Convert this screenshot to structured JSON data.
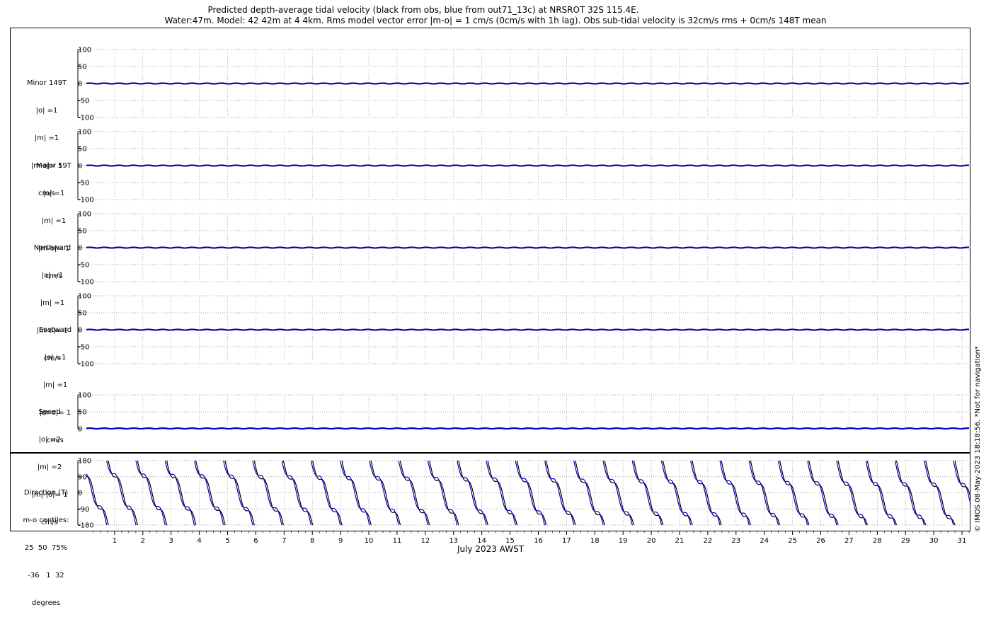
{
  "title_line1": "Predicted depth-average tidal velocity (black from obs, blue from out71_13c) at NRSROT 32S 115.4E.",
  "title_line2": "Water:47m. Model: 42 42m at 4 4km. Rms model vector error |m-o| = 1 cm/s (0cm/s with 1h lag). Obs sub-tidal velocity is 32cm/s rms + 0cm/s 148T mean",
  "credit": "© IMOS 08-May-2023 18:18:56. *Not for navigation*",
  "colors": {
    "obs": "#000000",
    "model": "#0000cc",
    "grid": "#888888"
  },
  "chart_data": [
    {
      "type": "line",
      "panel_label": [
        "Minor 149T",
        "|o| =1",
        "|m| =1",
        "|m-o|= 1",
        "cm/s"
      ],
      "yticks": [
        100,
        50,
        0,
        -50,
        -100
      ],
      "ytick_labels": [
        "100",
        "50",
        "0",
        "-50",
        "-100"
      ],
      "ylim": [
        -100,
        100
      ],
      "series": [
        {
          "color": "obs",
          "amplitude": 1,
          "mean": 0
        },
        {
          "color": "model",
          "amplitude": 1,
          "mean": 0
        }
      ]
    },
    {
      "type": "line",
      "panel_label": [
        "Major 59T",
        "|o| =1",
        "|m| =1",
        "|m-o|= 1",
        "cm/s"
      ],
      "yticks": [
        100,
        50,
        0,
        -50,
        -100
      ],
      "ytick_labels": [
        "100",
        "50",
        "0",
        "-50",
        "-100"
      ],
      "ylim": [
        -100,
        100
      ],
      "series": [
        {
          "color": "obs",
          "amplitude": 1,
          "mean": 0
        },
        {
          "color": "model",
          "amplitude": 1,
          "mean": 0
        }
      ]
    },
    {
      "type": "line",
      "panel_label": [
        "Northward",
        "|o| =1",
        "|m| =1",
        "|m-o|= 1",
        "cm/s"
      ],
      "yticks": [
        100,
        50,
        0,
        -50,
        -100
      ],
      "ytick_labels": [
        "100",
        "50",
        "0",
        "-50",
        "-100"
      ],
      "ylim": [
        -100,
        100
      ],
      "series": [
        {
          "color": "obs",
          "amplitude": 1,
          "mean": 0
        },
        {
          "color": "model",
          "amplitude": 1,
          "mean": 0
        }
      ]
    },
    {
      "type": "line",
      "panel_label": [
        "Eastward",
        "|o| =1",
        "|m| =1",
        "|m-o|= 1",
        "cm/s"
      ],
      "yticks": [
        100,
        50,
        0,
        -50,
        -100
      ],
      "ytick_labels": [
        "100",
        "50",
        "0",
        "-50",
        "-100"
      ],
      "ylim": [
        -100,
        100
      ],
      "series": [
        {
          "color": "obs",
          "amplitude": 1,
          "mean": 0
        },
        {
          "color": "model",
          "amplitude": 1,
          "mean": 0
        }
      ]
    },
    {
      "type": "line",
      "panel_label": [
        "Speed",
        "|o| =2",
        "|m| =2",
        "|m|-|o|= 1",
        "cm/s"
      ],
      "yticks": [
        100,
        50,
        0
      ],
      "ytick_labels": [
        "100",
        "50",
        "0"
      ],
      "ylim": [
        0,
        100
      ],
      "series": [
        {
          "color": "obs",
          "amplitude": 1,
          "mean": 1
        },
        {
          "color": "model",
          "amplitude": 1,
          "mean": 1
        }
      ]
    },
    {
      "type": "line",
      "panel_label": [
        "Direction (T)",
        "m-o centiles:",
        "25  50  75%",
        "-36   1  32",
        "degrees"
      ],
      "yticks": [
        180,
        90,
        0,
        -90,
        -180
      ],
      "ytick_labels": [
        "180",
        "90",
        "0",
        "-90",
        "-180"
      ],
      "ylim": [
        -180,
        180
      ],
      "series": [
        {
          "color": "obs",
          "wrapped": true,
          "cycles_per_day": 0.97,
          "phase_deg": 90
        },
        {
          "color": "model",
          "wrapped": true,
          "cycles_per_day": 0.97,
          "phase_deg": 80
        }
      ]
    }
  ],
  "xaxis": {
    "xlim": [
      0,
      31.3
    ],
    "ticks": [
      1,
      2,
      3,
      4,
      5,
      6,
      7,
      8,
      9,
      10,
      11,
      12,
      13,
      14,
      15,
      16,
      17,
      18,
      19,
      20,
      21,
      22,
      23,
      24,
      25,
      26,
      27,
      28,
      29,
      30,
      31
    ],
    "tick_labels": [
      "1",
      "2",
      "3",
      "4",
      "5",
      "6",
      "7",
      "8",
      "9",
      "10",
      "11",
      "12",
      "13",
      "14",
      "15",
      "16",
      "17",
      "18",
      "19",
      "20",
      "21",
      "22",
      "23",
      "24",
      "25",
      "26",
      "27",
      "28",
      "29",
      "30",
      "31"
    ],
    "label": "July 2023 AWST"
  }
}
